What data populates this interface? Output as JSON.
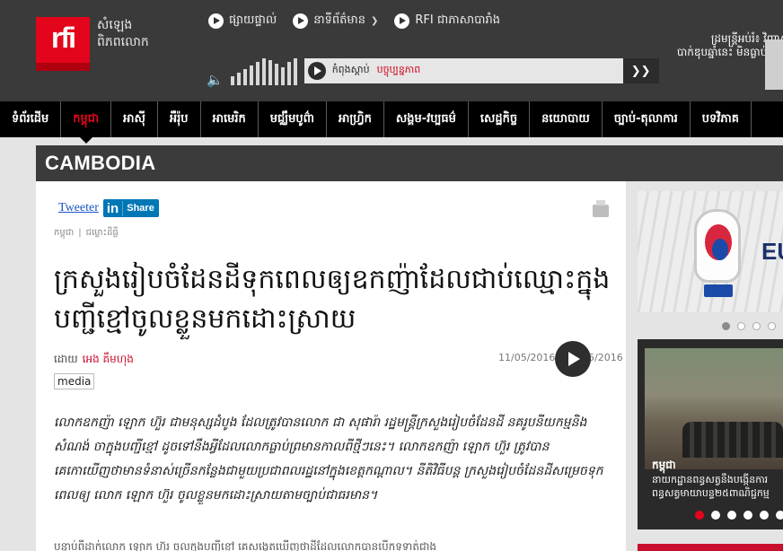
{
  "brand": {
    "logo_text": "rfi",
    "line1": "សំឡេង",
    "line2": "ពិភពលោក"
  },
  "top_links": [
    {
      "label": "ផ្សាយផ្ទាល់",
      "has_chevron": false
    },
    {
      "label": "នាទីព័ត៌មាន",
      "has_chevron": true
    },
    {
      "label": "RFI ជាភាសាបារាំង",
      "has_chevron": false
    }
  ],
  "player": {
    "live_label": "កំពុងស្ដាប់",
    "program": "បច្ចុប្បន្នភាព",
    "volume_icon": "speaker-icon",
    "dropdown_icon": "chevron-down-icon"
  },
  "ad": {
    "line1": "ដ្រមន្ត្រីអប់រំ៖ វិញ្ញាសា",
    "line2": "បាក់ឌុបឆ្នាំនេះ មិនធ្លាប់ប្រឡង",
    "line3": "ឆ្នាំមុន"
  },
  "nav": [
    {
      "label": "ទំព័រដើម",
      "active": false
    },
    {
      "label": "កម្ពុជា",
      "active": true
    },
    {
      "label": "អាស៊ី",
      "active": false
    },
    {
      "label": "អឺរ៉ុប",
      "active": false
    },
    {
      "label": "អាមេរិក",
      "active": false
    },
    {
      "label": "មជ្ឈឹមបូព៌ា",
      "active": false
    },
    {
      "label": "អាហ្វ្រិក",
      "active": false
    },
    {
      "label": "សង្គម-វប្បធម៌",
      "active": false
    },
    {
      "label": "សេដ្ឋកិច្ច",
      "active": false
    },
    {
      "label": "នយោបាយ",
      "active": false
    },
    {
      "label": "ច្បាប់-តុលាការ",
      "active": false
    },
    {
      "label": "បទវិភាគ",
      "active": false
    }
  ],
  "section_title": "CAMBODIA",
  "article": {
    "tweet_label": "Tweeter",
    "linkedin_in": "in",
    "linkedin_share": "Share",
    "breadcrumb": [
      "កម្ពុជា",
      "ជម្លោះដីធ្លី"
    ],
    "breadcrumb_sep": "|",
    "title": "ក្រសួងរៀបចំដែនដីទុកពេលឲ្យឧកញ៉ាដែលជាប់ឈ្មោះក្នុងបញ្ជីខ្មៅចូលខ្លួនមកដោះស្រាយ",
    "by_label": "ដោយ",
    "author": "អេង គឹមហុង",
    "date_published": "11/05/2016",
    "date_sep": "-",
    "date_modified": "11/05/2016",
    "tag": "media",
    "lead": "លោកឧកញ៉ា ឡោក ហ៊ួរ ជាមនុស្សដំបូង ដែលត្រូវបានលោក ជា សុផារ៉ា រដ្ឋមន្ត្រីក្រសួងរៀបចំដែនដី នគរូបនីយកម្មនិងសំណង់ ចាក្នុងបញ្ជីខ្មៅ ដូចទៅនឹងអ្វីដែលលោកធ្លាប់ព្រមានកាលពីថ្មីៗនេះ។ លោកឧកញ៉ា ឡោក ហ៊ួរ ត្រូវបានគេកោយើញថាមានទំនាស់ច្រើនកន្លែងជាមួយប្រជាពលរដ្ឋនៅក្នុងខេត្តកណ្ដាល។ នីតិវិធីបន្ត ក្រសួងរៀបចំដែនដីសម្រេចទុកពេលឲ្យ លោក ឡោក ហ៊ួរ ចូលខ្លួនមកដោះស្រាយតាមច្បាប់ជាធរមាន។",
    "body_start": "បន្ទាប់ពីដាក់លោក ឡោក ហ៊ួរ ចូលក្នុងបញ្ជីខ្មៅ គេសង្កេតឃើញថាដីដែលលោកបានបើកទូទាត់ជាង"
  },
  "sidebar": {
    "card1_text": "EU",
    "card1_dots": 4,
    "card2_category": "កម្ពុជា",
    "card2_caption_line1": "នាយកដ្ឋានពន្ធសត្វនឹងបង្កើនការ",
    "card2_caption_line2": "ពន្ធសត្វមាយាបន្ទ២៥ពាណិជ្ជកម្ម",
    "card2_dots": 6
  }
}
